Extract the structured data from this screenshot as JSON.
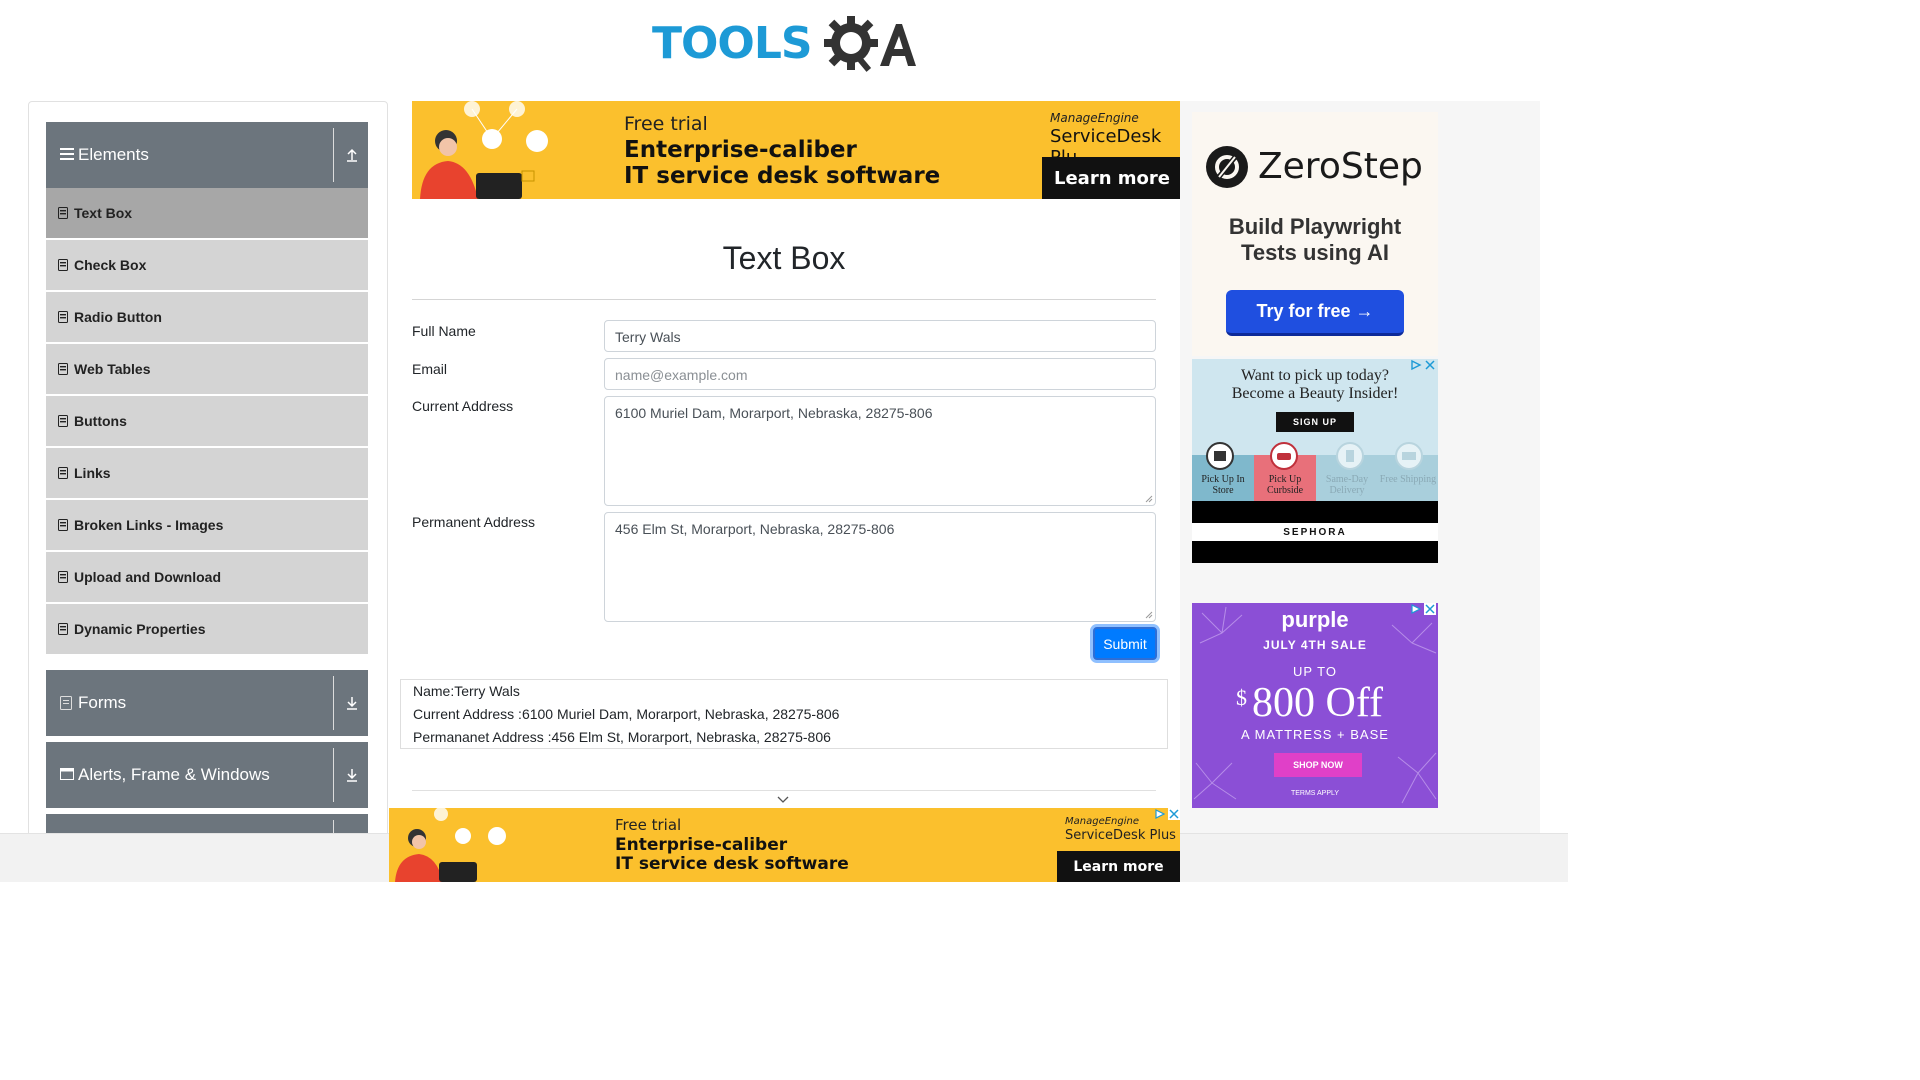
{
  "logo": {
    "tools": "TOOLS",
    "qa": "QA"
  },
  "sidebar": {
    "elements_title": "Elements",
    "items": [
      "Text Box",
      "Check Box",
      "Radio Button",
      "Web Tables",
      "Buttons",
      "Links",
      "Broken Links - Images",
      "Upload and Download",
      "Dynamic Properties"
    ],
    "forms_title": "Forms",
    "alerts_title": "Alerts, Frame & Windows"
  },
  "ad_top": {
    "line1": "Free trial",
    "line2": "Enterprise-caliber",
    "line3": "IT service desk software",
    "brand_small": "ManageEngine",
    "brand": "ServiceDesk Plu",
    "cta": "Learn more"
  },
  "ad_bottom": {
    "line1": "Free trial",
    "line2": "Enterprise-caliber",
    "line3": "IT service desk software",
    "brand_small": "ManageEngine",
    "brand": "ServiceDesk Plus",
    "cta": "Learn more"
  },
  "ad_zerostep": {
    "brand": "ZeroStep",
    "tagline1": "Build Playwright",
    "tagline2": "Tests using AI",
    "cta": "Try for free →"
  },
  "ad_sephora": {
    "line1": "Want to pick up today?",
    "line2": "Become a Beauty Insider!",
    "cta": "SIGN UP",
    "opt1": "Pick Up In Store",
    "opt2": "Pick Up Curbside",
    "opt3": "Same-Day Delivery",
    "opt4": "Free Shipping",
    "brand": "SEPHORA"
  },
  "ad_purple": {
    "brand": "purple",
    "sale": "JULY 4TH SALE",
    "upto": "UP TO",
    "dollar": "$",
    "amount": "800 Off",
    "sub": "A MATTRESS + BASE",
    "cta": "SHOP NOW",
    "terms": "TERMS APPLY"
  },
  "form": {
    "title": "Text Box",
    "full_name_label": "Full Name",
    "full_name_value": "Terry Wals",
    "email_label": "Email",
    "email_placeholder": "name@example.com",
    "current_address_label": "Current Address",
    "current_address_value": "6100 Muriel Dam, Morarport, Nebraska, 28275-806",
    "permanent_address_label": "Permanent Address",
    "permanent_address_value": "456 Elm St, Morarport, Nebraska, 28275-806",
    "submit_label": "Submit"
  },
  "output": {
    "name": "Name:Terry Wals",
    "current": "Current Address :6100 Muriel Dam, Morarport, Nebraska, 28275-806",
    "permanent": "Permananet Address :456 Elm St, Morarport, Nebraska, 28275-806"
  },
  "colors": {
    "accent": "#007bff",
    "sidebar_header": "#6c757d",
    "sidebar_item": "#d4d4d4",
    "sidebar_active": "#a7a7a7",
    "ad_yellow": "#fbc02d",
    "zerostep_cta": "#1f4fe0",
    "purple_bg": "#8b4fd6"
  }
}
